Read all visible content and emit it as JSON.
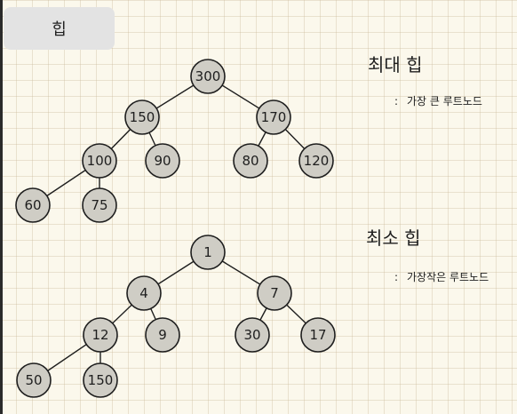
{
  "tab": {
    "label": "힙"
  },
  "max_heap": {
    "title": "최대 힙",
    "description": "가장 큰 루트노드",
    "bullet": ":",
    "nodes": [
      "300",
      "150",
      "170",
      "100",
      "90",
      "80",
      "120",
      "60",
      "75"
    ]
  },
  "min_heap": {
    "title": "최소 힙",
    "description": "가장작은 루트노드",
    "bullet": ":",
    "nodes": [
      "1",
      "4",
      "7",
      "12",
      "9",
      "30",
      "17",
      "50",
      "150"
    ]
  }
}
